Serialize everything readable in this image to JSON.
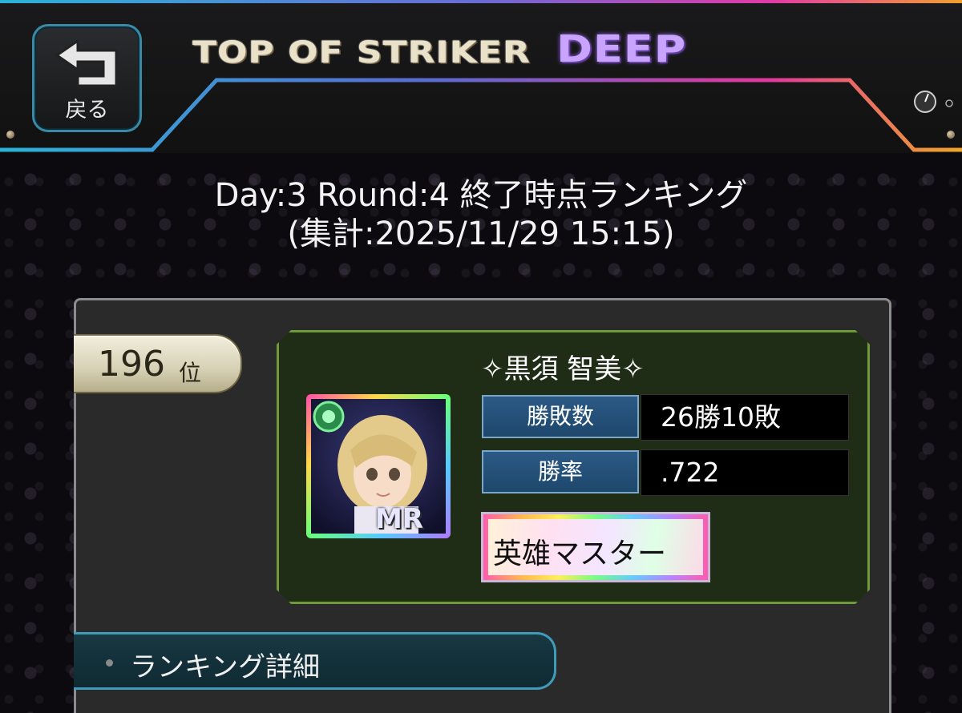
{
  "header": {
    "back_label": "戻る",
    "logo_main": "TOP OF STRIKER",
    "logo_sub": "DEEP"
  },
  "title": {
    "line1": "Day:3 Round:4 終了時点ランキング",
    "line2": "(集計:2025/11/29 15:15)"
  },
  "rank": {
    "number": "196",
    "unit": "位"
  },
  "player": {
    "name": "✧黒須 智美✧",
    "card_rarity": "MR",
    "stats": [
      {
        "label": "勝敗数",
        "value": "26勝10敗"
      },
      {
        "label": "勝率",
        "value": ".722"
      }
    ],
    "title_badge": "英雄マスター"
  },
  "detail": {
    "label": "ランキング詳細"
  },
  "colors": {
    "accent_cyan": "#3a8aa6",
    "accent_green": "#6f9a3a",
    "stat_blue": "#2b5a85"
  }
}
